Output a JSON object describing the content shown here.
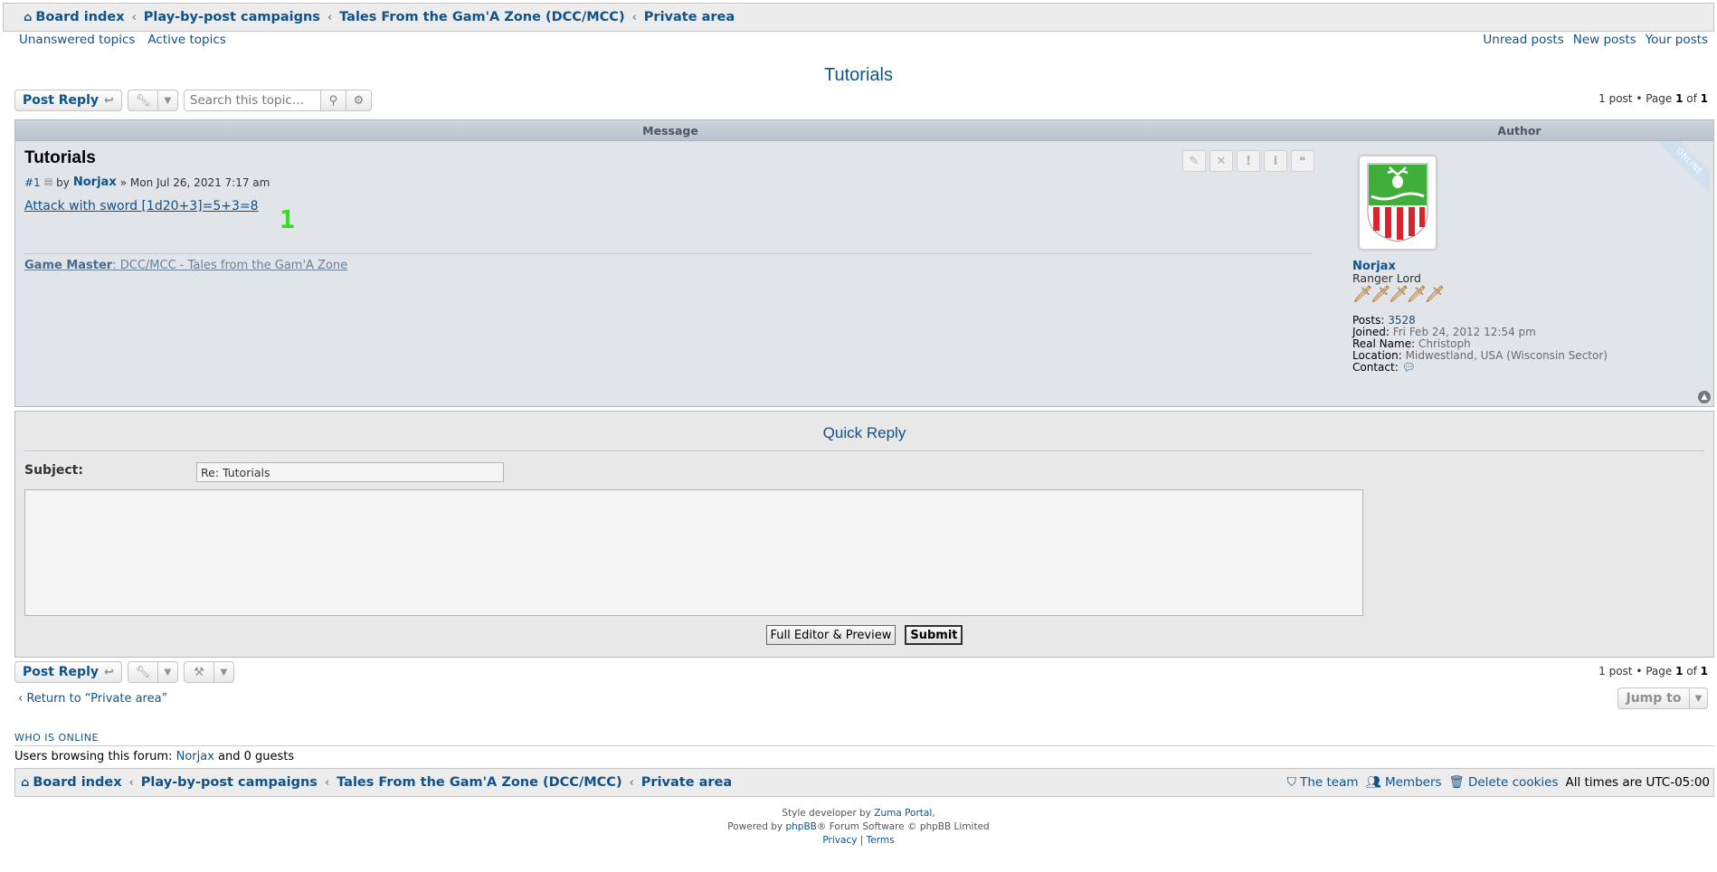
{
  "breadcrumbs": {
    "home_icon": "home-icon",
    "items": [
      "Board index",
      "Play-by-post campaigns",
      "Tales From the Gam'A Zone (DCC/MCC)",
      "Private area"
    ]
  },
  "quicklinks": {
    "left": [
      "Unanswered topics",
      "Active topics"
    ],
    "right": [
      "Unread posts",
      "New posts",
      "Your posts"
    ]
  },
  "topic": {
    "title": "Tutorials"
  },
  "actions": {
    "post_reply": "Post Reply",
    "search_placeholder": "Search this topic…",
    "pagination_top": {
      "count": "1 post • Page ",
      "page": "1",
      "of": " of ",
      "total": "1"
    }
  },
  "table": {
    "col_message": "Message",
    "col_author": "Author"
  },
  "post": {
    "title": "Tutorials",
    "number": "#1",
    "by": "by",
    "author": "Norjax",
    "date": "» Mon Jul 26, 2021 7:17 am",
    "dice_text": "Attack with sword [1d20+3]=5+3=8",
    "big_number": "1",
    "signature_label": "Game Master",
    "signature_text": ": DCC/MCC - Tales from the Gam'A Zone",
    "online_label": "ONLINE"
  },
  "author_profile": {
    "name": "Norjax",
    "rank": "Ranger Lord",
    "posts_label": "Posts:",
    "posts": "3528",
    "joined_label": "Joined:",
    "joined": "Fri Feb 24, 2012 12:54 pm",
    "realname_label": "Real Name:",
    "realname": "Christoph",
    "location_label": "Location:",
    "location": "Midwestland, USA (Wisconsin Sector)",
    "contact_label": "Contact:"
  },
  "quick_reply": {
    "title": "Quick Reply",
    "subject_label": "Subject:",
    "subject_value": "Re: Tutorials",
    "full_editor": "Full Editor & Preview",
    "submit": "Submit"
  },
  "bottom": {
    "post_reply": "Post Reply",
    "pagination": {
      "count": "1 post • Page ",
      "page": "1",
      "of": " of ",
      "total": "1"
    },
    "return_link": "Return to “Private area”",
    "jump_to": "Jump to"
  },
  "who_is_online": {
    "title": "WHO IS ONLINE",
    "text_before": "Users browsing this forum: ",
    "user": "Norjax",
    "text_after": " and 0 guests"
  },
  "footer": {
    "team": "The team",
    "members": "Members",
    "delete_cookies": "Delete cookies",
    "timezone": "All times are UTC-05:00"
  },
  "copyright": {
    "style_dev_prefix": "Style developer by ",
    "style_dev": "Zuma Portal",
    "style_dev_suffix": ",",
    "powered_prefix": "Powered by ",
    "phpbb": "phpBB",
    "powered_suffix": "® Forum Software © phpBB Limited",
    "privacy": "Privacy",
    "sep": " | ",
    "terms": "Terms"
  },
  "colors": {
    "link": "#105289",
    "header_bg": "#ececec",
    "post_bg": "#e1e4e8",
    "green_number": "#2de01a"
  }
}
